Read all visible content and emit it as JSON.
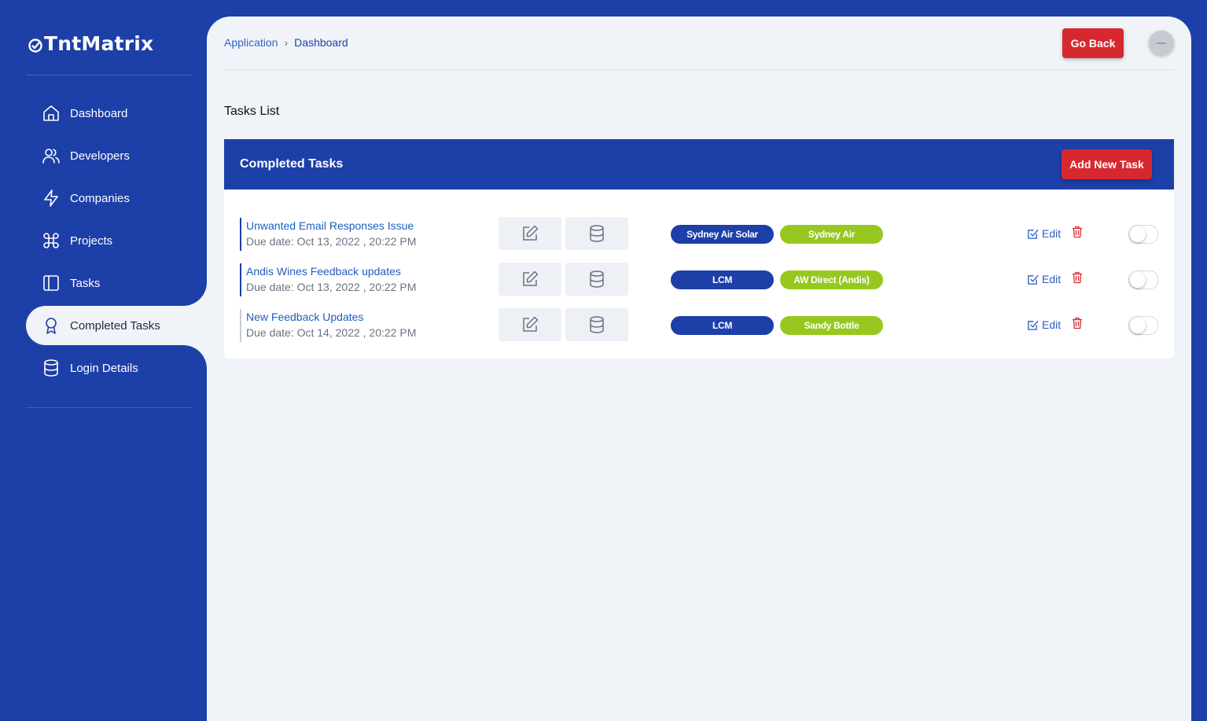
{
  "app": {
    "name": "TntMatrix"
  },
  "sidebar": {
    "items": [
      {
        "label": "Dashboard",
        "icon": "home-icon"
      },
      {
        "label": "Developers",
        "icon": "users-icon"
      },
      {
        "label": "Companies",
        "icon": "lightning-icon"
      },
      {
        "label": "Projects",
        "icon": "command-icon"
      },
      {
        "label": "Tasks",
        "icon": "sidebar-panel-icon"
      },
      {
        "label": "Completed Tasks",
        "icon": "award-icon",
        "active": true
      },
      {
        "label": "Login Details",
        "icon": "database-icon"
      }
    ]
  },
  "header": {
    "breadcrumb": [
      "Application",
      "Dashboard"
    ],
    "breadcrumb_separator": "›",
    "go_back_label": "Go Back"
  },
  "page": {
    "section_title": "Tasks List"
  },
  "card": {
    "title": "Completed Tasks",
    "add_button_label": "Add New Task",
    "tasks": [
      {
        "title": "Unwanted Email Responses Issue",
        "due": "Due date: Oct 13, 2022 , 20:22 PM",
        "tag_blue": "Sydney Air Solar",
        "tag_green": "Sydney Air",
        "edit_label": "Edit"
      },
      {
        "title": "Andis Wines Feedback updates",
        "due": "Due date: Oct 13, 2022 , 20:22 PM",
        "tag_blue": "LCM",
        "tag_green": "AW Direct (Andis)",
        "edit_label": "Edit"
      },
      {
        "title": "New Feedback Updates",
        "due": "Due date: Oct 14, 2022 , 20:22 PM",
        "tag_blue": "LCM",
        "tag_green": "Sandy Bottle",
        "edit_label": "Edit"
      }
    ]
  },
  "colors": {
    "primary": "#1d3fa8",
    "danger": "#d7282f",
    "accent_green": "#97c81f",
    "panel_bg": "#f0f4f9"
  }
}
